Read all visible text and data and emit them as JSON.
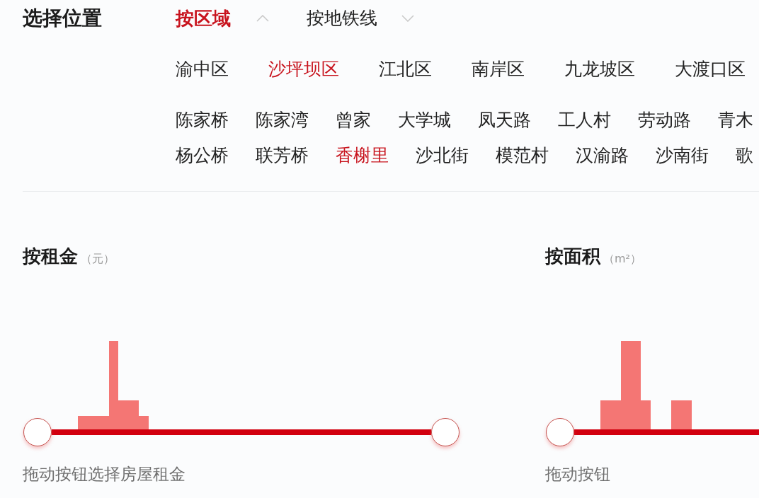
{
  "section_title": "选择位置",
  "tabs": [
    {
      "label": "按区域",
      "selected": true
    },
    {
      "label": "按地铁线",
      "selected": false
    }
  ],
  "districts": [
    {
      "label": "渝中区",
      "selected": false
    },
    {
      "label": "沙坪坝区",
      "selected": true
    },
    {
      "label": "江北区",
      "selected": false
    },
    {
      "label": "南岸区",
      "selected": false
    },
    {
      "label": "九龙坡区",
      "selected": false
    },
    {
      "label": "大渡口区",
      "selected": false
    }
  ],
  "street_rows": [
    {
      "items": [
        {
          "label": "陈家桥",
          "selected": false
        },
        {
          "label": "陈家湾",
          "selected": false
        },
        {
          "label": "曾家",
          "selected": false
        },
        {
          "label": "大学城",
          "selected": false
        },
        {
          "label": "凤天路",
          "selected": false
        },
        {
          "label": "工人村",
          "selected": false
        },
        {
          "label": "劳动路",
          "selected": false
        },
        {
          "label": "青木",
          "selected": false
        }
      ]
    },
    {
      "items": [
        {
          "label": "杨公桥",
          "selected": false
        },
        {
          "label": "联芳桥",
          "selected": false
        },
        {
          "label": "香榭里",
          "selected": true
        },
        {
          "label": "沙北街",
          "selected": false
        },
        {
          "label": "模范村",
          "selected": false
        },
        {
          "label": "汉渝路",
          "selected": false
        },
        {
          "label": "沙南街",
          "selected": false
        },
        {
          "label": "歌",
          "selected": false
        }
      ]
    }
  ],
  "filters": [
    {
      "title": "按租金",
      "unit": "（元）",
      "slider": {
        "thumbs": [
          {
            "level": 0
          },
          {
            "level": 1
          }
        ]
      },
      "hint": "拖动按钮选择房屋租金"
    },
    {
      "title": "按面积",
      "unit": "（m²）",
      "slider": {
        "thumbs": [
          {
            "level": 0
          }
        ]
      },
      "hint": "拖动按钮"
    }
  ]
}
